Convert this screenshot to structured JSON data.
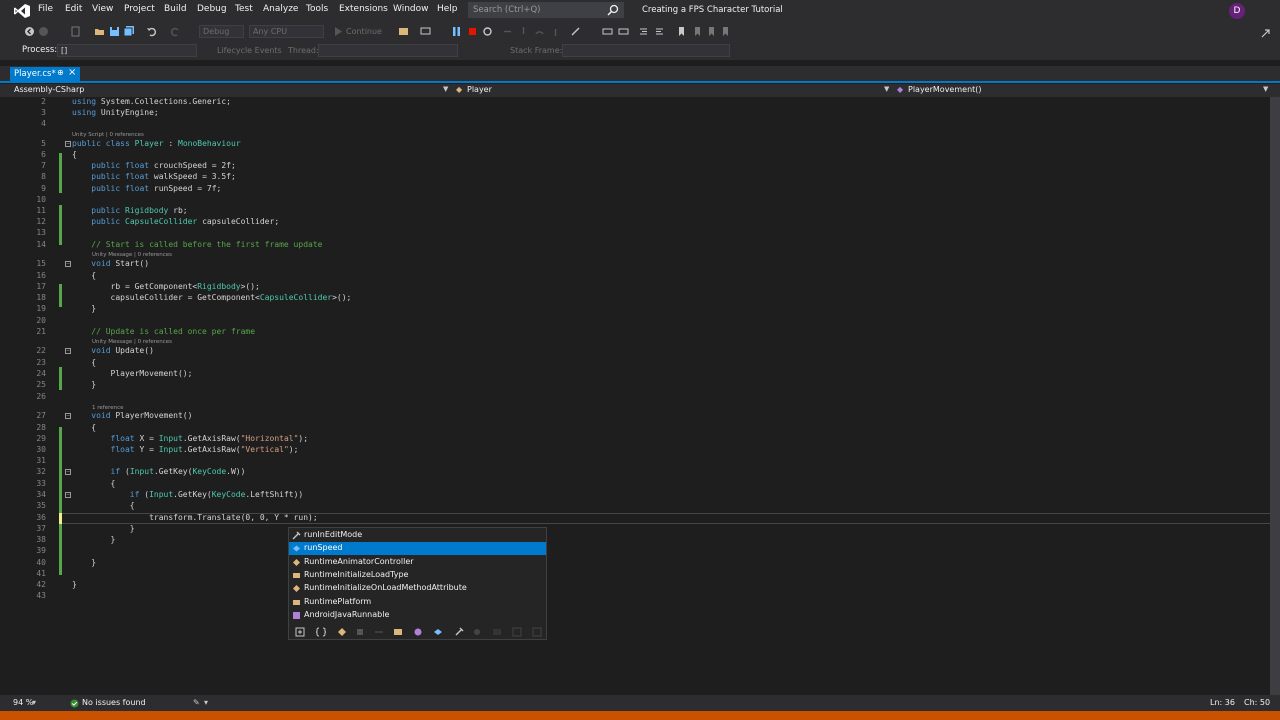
{
  "menubar": {
    "items": [
      "File",
      "Edit",
      "View",
      "Project",
      "Build",
      "Debug",
      "Test",
      "Analyze",
      "Tools",
      "Extensions",
      "Window",
      "Help"
    ],
    "search_placeholder": "Search (Ctrl+Q)",
    "window_title": "Creating a FPS Character Tutorial",
    "avatar_initial": "D"
  },
  "toolbar": {
    "config": "Debug",
    "platform": "Any CPU",
    "continue_label": "Continue",
    "lifecycle_label": "Lifecycle Events",
    "thread_label": "Thread:",
    "stackframe_label": "Stack Frame:"
  },
  "processbar": {
    "label": "Process:",
    "value": "[]"
  },
  "tab": {
    "label": "Player.cs*",
    "pin": "⊕",
    "close": "×"
  },
  "navbar": {
    "project": "Assembly-CSharp",
    "class": "Player",
    "member": "PlayerMovement()"
  },
  "editor": {
    "lines": [
      {
        "n": "2",
        "html": "<span class='kw'>using</span> System.Collections.Generic;"
      },
      {
        "n": "3",
        "html": "<span class='kw'>using</span> UnityEngine;"
      },
      {
        "n": "4",
        "html": ""
      },
      {
        "n": "5",
        "html": "<span class='kw'>public</span> <span class='kw'>class</span> <span class='ty'>Player</span> : <span class='ty'>MonoBehaviour</span>"
      },
      {
        "n": "6",
        "html": "{"
      },
      {
        "n": "7",
        "html": "    <span class='kw'>public</span> <span class='kw'>float</span> crouchSpeed = 2f;"
      },
      {
        "n": "8",
        "html": "    <span class='kw'>public</span> <span class='kw'>float</span> walkSpeed = 3.5f;"
      },
      {
        "n": "9",
        "html": "    <span class='kw'>public</span> <span class='kw'>float</span> runSpeed = 7f;"
      },
      {
        "n": "10",
        "html": ""
      },
      {
        "n": "11",
        "html": "    <span class='kw'>public</span> <span class='ty'>Rigidbody</span> rb;"
      },
      {
        "n": "12",
        "html": "    <span class='kw'>public</span> <span class='ty'>CapsuleCollider</span> capsuleCollider;"
      },
      {
        "n": "13",
        "html": ""
      },
      {
        "n": "14",
        "html": "    <span class='cm'>// Start is called before the first frame update</span>"
      },
      {
        "n": "15",
        "html": "    <span class='kw'>void</span> Start()"
      },
      {
        "n": "16",
        "html": "    {"
      },
      {
        "n": "17",
        "html": "        rb = GetComponent&lt;<span class='ty'>Rigidbody</span>&gt;();"
      },
      {
        "n": "18",
        "html": "        capsuleCollider = GetComponent&lt;<span class='ty'>CapsuleCollider</span>&gt;();"
      },
      {
        "n": "19",
        "html": "    }"
      },
      {
        "n": "20",
        "html": ""
      },
      {
        "n": "21",
        "html": "    <span class='cm'>// Update is called once per frame</span>"
      },
      {
        "n": "22",
        "html": "    <span class='kw'>void</span> Update()"
      },
      {
        "n": "23",
        "html": "    {"
      },
      {
        "n": "24",
        "html": "        PlayerMovement();"
      },
      {
        "n": "25",
        "html": "    }"
      },
      {
        "n": "26",
        "html": ""
      },
      {
        "n": "27",
        "html": "    <span class='kw'>void</span> PlayerMovement()"
      },
      {
        "n": "28",
        "html": "    {"
      },
      {
        "n": "29",
        "html": "        <span class='kw'>float</span> X = <span class='ty'>Input</span>.GetAxisRaw(<span class='str'>\"Horizontal\"</span>);"
      },
      {
        "n": "30",
        "html": "        <span class='kw'>float</span> Y = <span class='ty'>Input</span>.GetAxisRaw(<span class='str'>\"Vertical\"</span>);"
      },
      {
        "n": "31",
        "html": ""
      },
      {
        "n": "32",
        "html": "        <span class='kw'>if</span> (<span class='ty'>Input</span>.GetKey(<span class='ty'>KeyCode</span>.W))"
      },
      {
        "n": "33",
        "html": "        {"
      },
      {
        "n": "34",
        "html": "            <span class='kw'>if</span> (<span class='ty'>Input</span>.GetKey(<span class='ty'>KeyCode</span>.LeftShift))"
      },
      {
        "n": "35",
        "html": "            {"
      },
      {
        "n": "36",
        "html": "                transform.Translate(0, 0, Y * run);"
      },
      {
        "n": "37",
        "html": "            }"
      },
      {
        "n": "38",
        "html": "        }"
      },
      {
        "n": "39",
        "html": ""
      },
      {
        "n": "40",
        "html": "    }"
      },
      {
        "n": "41",
        "html": ""
      },
      {
        "n": "42",
        "html": "}"
      },
      {
        "n": "43",
        "html": ""
      }
    ],
    "codelens": {
      "class": "Unity Script | 0 references",
      "start": "Unity Message | 0 references",
      "update": "Unity Message | 0 references",
      "movement": "1 reference"
    }
  },
  "completion": {
    "items": [
      {
        "label": "runInEditMode",
        "icon": "property-icon"
      },
      {
        "label": "runSpeed",
        "icon": "field-icon",
        "selected": true
      },
      {
        "label": "RuntimeAnimatorController",
        "icon": "class-icon"
      },
      {
        "label": "RuntimeInitializeLoadType",
        "icon": "enum-icon"
      },
      {
        "label": "RuntimeInitializeOnLoadMethodAttribute",
        "icon": "class-icon"
      },
      {
        "label": "RuntimePlatform",
        "icon": "enum-icon"
      },
      {
        "label": "AndroidJavaRunnable",
        "icon": "delegate-icon"
      }
    ]
  },
  "statusbar": {
    "zoom": "94 %",
    "issues": "No issues found",
    "line": "Ln: 36",
    "col": "Ch: 50"
  },
  "colors": {
    "accent": "#007acc",
    "status_orange": "#ca5100"
  }
}
